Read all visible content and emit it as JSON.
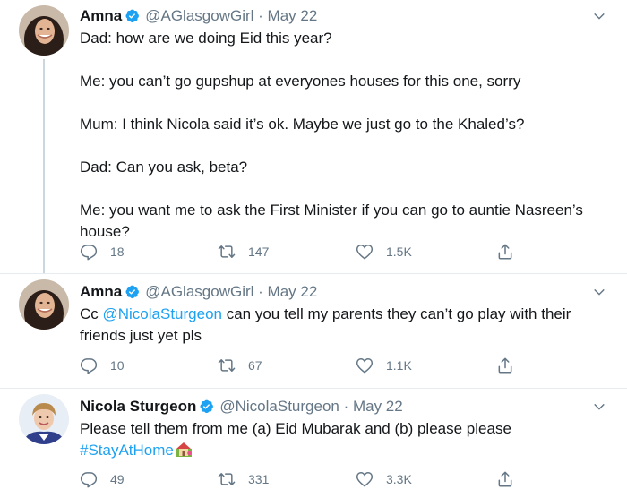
{
  "tweets": [
    {
      "name": "Amna",
      "handle": "@AGlasgowGirl",
      "dot": " · ",
      "date": "May 22",
      "lines": [
        "Dad: how are we doing Eid this year?",
        "Me: you can’t go gupshup at everyones houses for this one, sorry",
        "Mum: I think Nicola said it’s ok. Maybe we just go to the Khaled’s?",
        "Dad: Can you ask, beta?",
        "Me: you want me to ask the First Minister if you can go to auntie Nasreen’s house?"
      ],
      "replies": "18",
      "retweets": "147",
      "likes": "1.5K"
    },
    {
      "name": "Amna",
      "handle": "@AGlasgowGirl",
      "dot": " · ",
      "date": "May 22",
      "text_prefix": "Cc ",
      "mention": "@NicolaSturgeon",
      "text_suffix": " can you tell my parents they can’t go play with their friends just yet pls",
      "replies": "10",
      "retweets": "67",
      "likes": "1.1K"
    },
    {
      "name": "Nicola Sturgeon",
      "handle": "@NicolaSturgeon",
      "dot": " · ",
      "date": "May 22",
      "text": "Please tell them from me (a) Eid Mubarak and (b) please please",
      "hashtag": "#StayAtHome",
      "replies": "49",
      "retweets": "331",
      "likes": "3.3K"
    }
  ],
  "icons": {
    "verified": "verified-badge-icon",
    "more": "chevron-down-icon",
    "reply": "reply-icon",
    "retweet": "retweet-icon",
    "like": "heart-icon",
    "share": "share-icon",
    "emoji": "house-with-garden-emoji"
  },
  "colors": {
    "link": "#1da1f2",
    "muted": "#657786",
    "text": "#14171a",
    "thread_line": "#ccd6dd"
  }
}
